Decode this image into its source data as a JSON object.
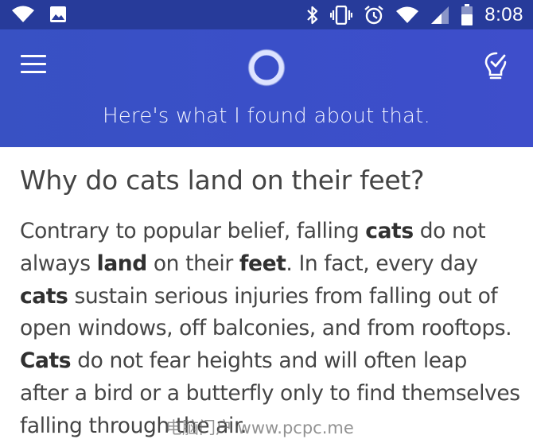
{
  "status_bar": {
    "time": "8:08",
    "left_icons": [
      "wifi-icon",
      "image-notification-icon"
    ],
    "right_icons": [
      "bluetooth-icon",
      "vibrate-icon",
      "alarm-icon",
      "wifi-signal-icon",
      "cell-signal-icon",
      "battery-icon"
    ]
  },
  "header": {
    "message": "Here's what I found about that.",
    "menu_icon": "hamburger-menu-icon",
    "assistant_icon": "cortana-ring-icon",
    "notebook_icon": "notebook-lightbulb-icon",
    "background_color": "#3a4fc5"
  },
  "answer": {
    "question": "Why do cats land on their feet?",
    "paragraph": [
      {
        "text": "Contrary to popular belief, falling ",
        "bold": false
      },
      {
        "text": "cats",
        "bold": true
      },
      {
        "text": " do not always ",
        "bold": false
      },
      {
        "text": "land",
        "bold": true
      },
      {
        "text": " on their ",
        "bold": false
      },
      {
        "text": "feet",
        "bold": true
      },
      {
        "text": ". In fact, every day ",
        "bold": false
      },
      {
        "text": "cats",
        "bold": true
      },
      {
        "text": " sustain serious injuries from falling out of open windows, off balconies, and from rooftops. ",
        "bold": false
      },
      {
        "text": "Cats",
        "bold": true
      },
      {
        "text": " do not fear heights and will often leap after a bird or a butterfly only to find themselves falling through the air.",
        "bold": false
      }
    ]
  },
  "watermark": "电脑门户 www.pcpc.me"
}
